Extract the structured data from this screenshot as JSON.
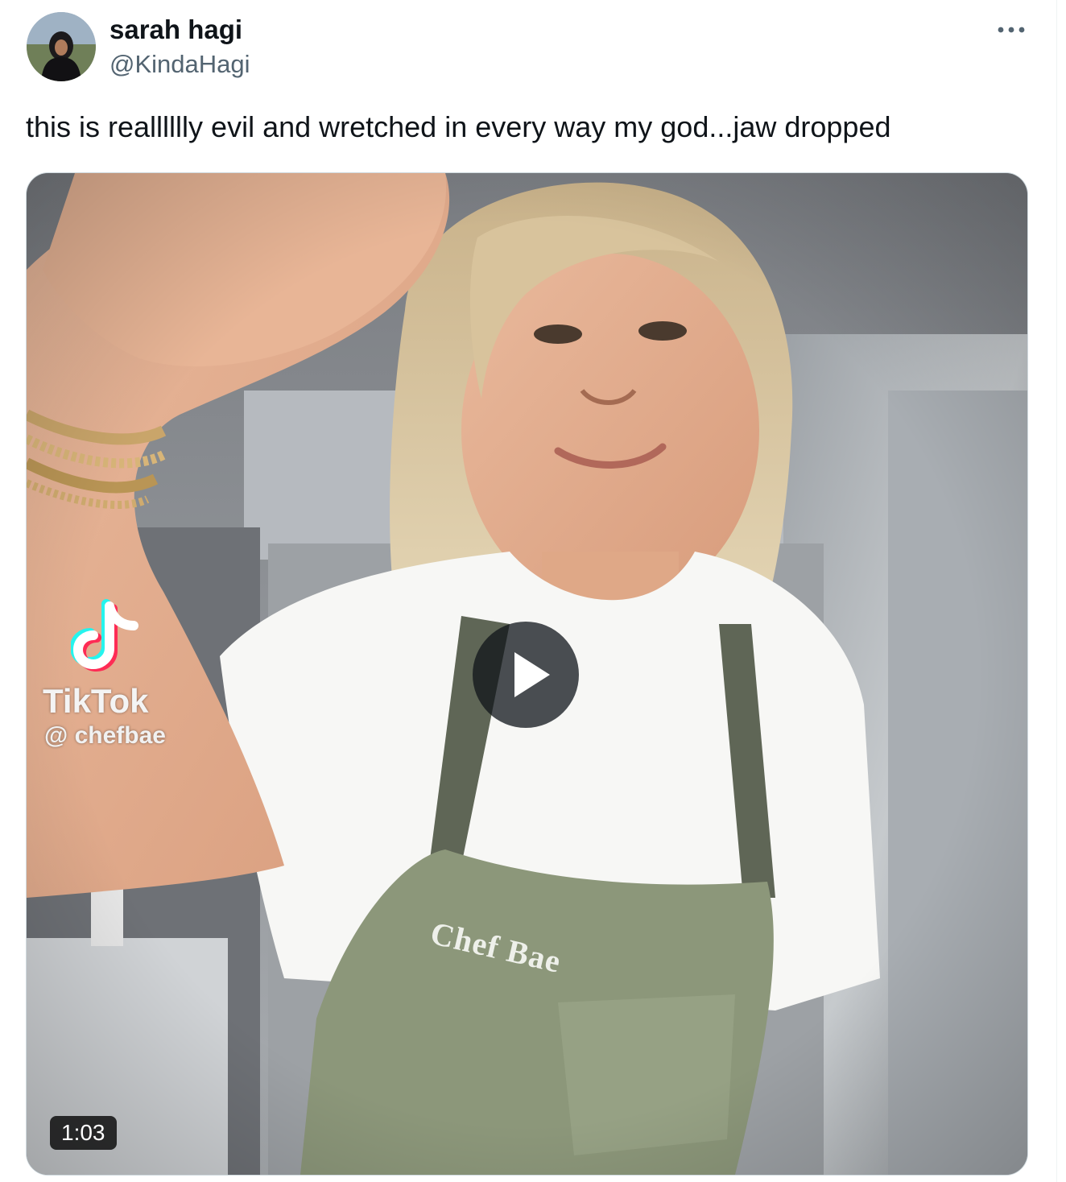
{
  "author": {
    "display_name": "sarah hagi",
    "handle": "@KindaHagi"
  },
  "tweet": {
    "text": "this is realllllly evil and wretched in every way my god...jaw dropped"
  },
  "media": {
    "type": "video",
    "watermark_platform": "TikTok",
    "watermark_user": "@ chefbae",
    "apron_text": "Chef Bae",
    "duration": "1:03",
    "play_icon": "play-icon"
  },
  "icons": {
    "more": "more-icon",
    "avatar": "avatar"
  },
  "colors": {
    "text_primary": "#0f1419",
    "text_secondary": "#536471",
    "border": "#cfd9de",
    "play_overlay": "#0f1419"
  }
}
